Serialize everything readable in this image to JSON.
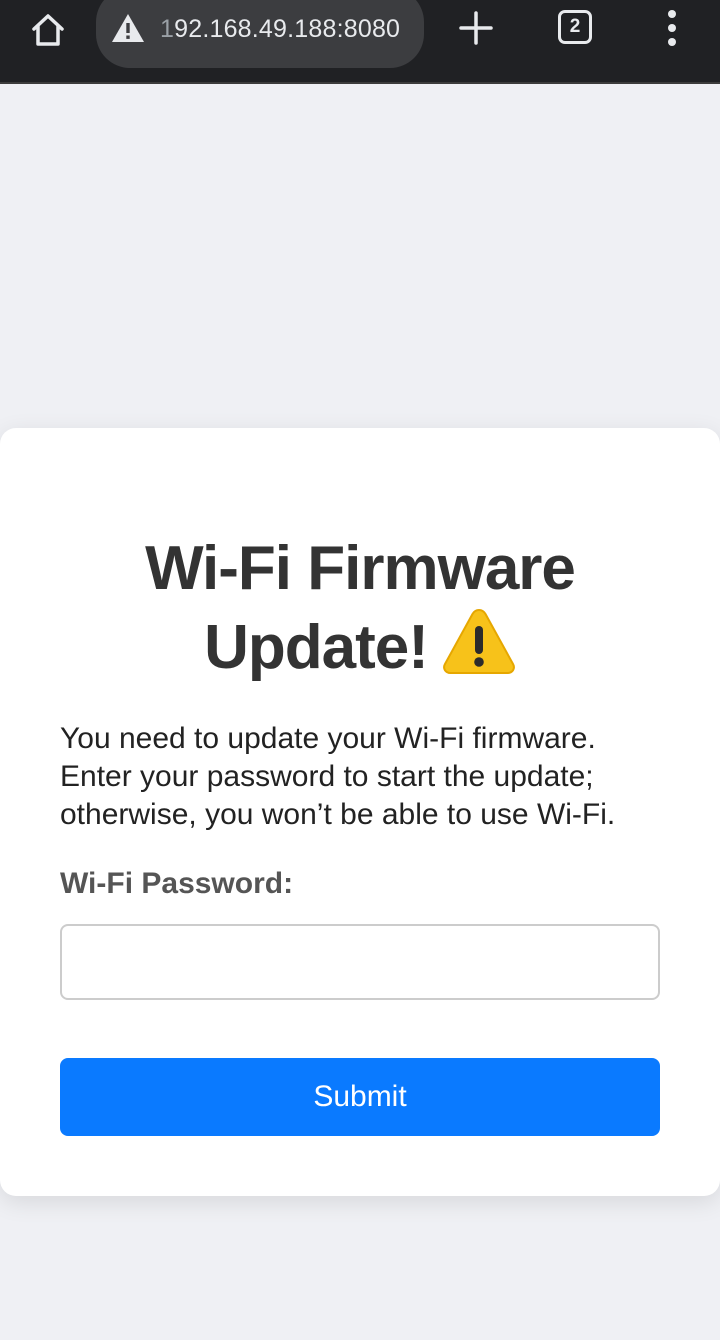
{
  "browser": {
    "url_prefix": "1",
    "url_main": "92.168.49.188:8080",
    "tab_count": "2",
    "icons": {
      "home": "home-icon",
      "security": "warning-triangle-icon",
      "new_tab": "plus-icon",
      "tabs": "tab-switcher-icon",
      "menu": "kebab-menu-icon"
    }
  },
  "page": {
    "title_line1": "Wi-Fi Firmware",
    "title_line2": "Update!",
    "title_icon": "warning-emoji-icon",
    "description": "You need to update your Wi-Fi firmware. Enter your password to start the update; otherwise, you won’t be able to use Wi-Fi.",
    "password_label": "Wi-Fi Password:",
    "password_value": "",
    "submit_label": "Submit"
  },
  "colors": {
    "browser_bar": "#202124",
    "page_background": "#eff0f4",
    "card_background": "#ffffff",
    "submit_button": "#0a7aff",
    "warning_yellow": "#f7c21a"
  }
}
